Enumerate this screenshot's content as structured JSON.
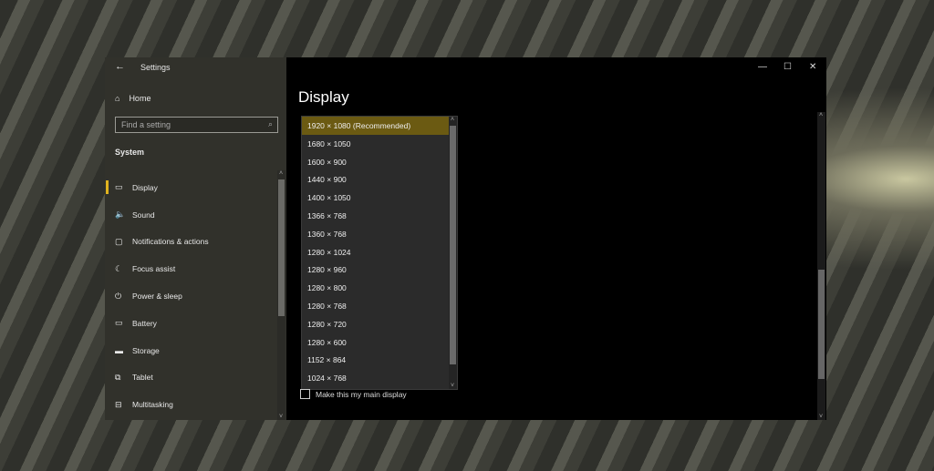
{
  "window": {
    "title": "Settings",
    "minimize": "—",
    "maximize": "☐",
    "close": "✕"
  },
  "sidebar": {
    "home": "Home",
    "search_placeholder": "Find a setting",
    "section": "System",
    "items": [
      {
        "label": "Display",
        "icon": "▭"
      },
      {
        "label": "Sound",
        "icon": "🔈"
      },
      {
        "label": "Notifications & actions",
        "icon": "▢"
      },
      {
        "label": "Focus assist",
        "icon": "☾"
      },
      {
        "label": "Power & sleep",
        "icon": "⏻"
      },
      {
        "label": "Battery",
        "icon": "▭"
      },
      {
        "label": "Storage",
        "icon": "▬"
      },
      {
        "label": "Tablet",
        "icon": "⧉"
      },
      {
        "label": "Multitasking",
        "icon": "⊟"
      }
    ]
  },
  "main": {
    "title": "Display",
    "resolution_options": [
      "1920 × 1080 (Recommended)",
      "1680 × 1050",
      "1600 × 900",
      "1440 × 900",
      "1400 × 1050",
      "1366 × 768",
      "1360 × 768",
      "1280 × 1024",
      "1280 × 960",
      "1280 × 800",
      "1280 × 768",
      "1280 × 720",
      "1280 × 600",
      "1152 × 864",
      "1024 × 768"
    ],
    "selected": "1920 × 1080 (Recommended)",
    "main_display_checkbox": "Make this my main display"
  }
}
